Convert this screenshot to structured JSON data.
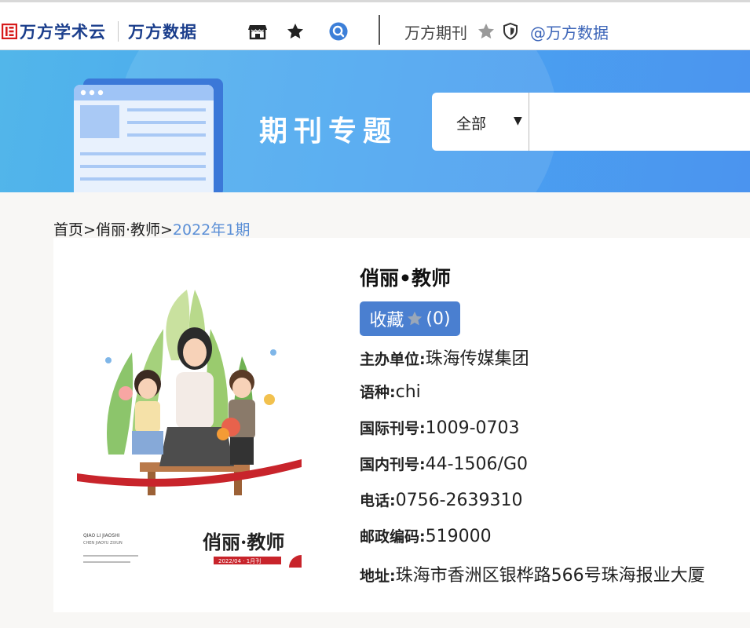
{
  "header": {
    "logo_primary": "万方学术云",
    "logo_secondary": "万方数据",
    "icons": [
      "store-icon",
      "star-icon",
      "search-circle-icon"
    ],
    "journal_label": "万方期刊",
    "journal_icons": [
      "star-icon",
      "shield-icon"
    ],
    "handle": "@万方数据",
    "brand_color": "#1b3e8c"
  },
  "banner": {
    "title": "期刊专题",
    "search": {
      "scope": "全部",
      "placeholder": ""
    }
  },
  "breadcrumb": {
    "home": "首页",
    "sep1": ">",
    "journal": "俏丽·教师",
    "sep2": ">",
    "issue": "2022年1期"
  },
  "journal": {
    "title": "俏丽•教师",
    "favorite": {
      "label": "收藏",
      "count": "(0)"
    },
    "fields": [
      {
        "label": "主办单位:",
        "value": "珠海传媒集团"
      },
      {
        "label": "语种:",
        "value": "chi"
      },
      {
        "label": "国际刊号:",
        "value": "1009-0703"
      },
      {
        "label": "国内刊号:",
        "value": "44-1506/G0"
      },
      {
        "label": "电话:",
        "value": "0756-2639310"
      },
      {
        "label": "邮政编码:",
        "value": "519000"
      },
      {
        "label": "地址:",
        "value": "珠海市香洲区银桦路566号珠海报业大厦"
      }
    ],
    "cover": {
      "title": "俏丽·教师",
      "issue_band": "2022/04 · 1月刊",
      "small_text_1": "QIAO LI JIAOSHI",
      "small_text_2": "CHEN JIAOYU ZIXUN"
    }
  },
  "colors": {
    "banner_start": "#52b6ea",
    "banner_end": "#4b94ef",
    "favorite_button": "#4a7fd0",
    "breadcrumb_current": "#5b8fd6",
    "link": "#3b64b8"
  }
}
